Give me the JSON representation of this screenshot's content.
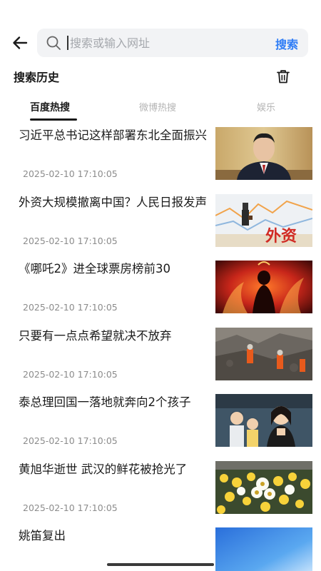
{
  "search": {
    "placeholder": "搜索或输入网址",
    "button_label": "搜索"
  },
  "history": {
    "title": "搜索历史"
  },
  "tabs": [
    {
      "label": "百度热搜",
      "active": true
    },
    {
      "label": "微博热搜",
      "active": false
    },
    {
      "label": "娱乐",
      "active": false
    }
  ],
  "news": [
    {
      "title": "习近平总书记这样部署东北全面振兴",
      "time": "2025-02-10 17:10:05"
    },
    {
      "title": "外资大规模撤离中国？人民日报发声",
      "time": "2025-02-10 17:10:05",
      "thumb_text": "外资"
    },
    {
      "title": "《哪吒2》进全球票房榜前30",
      "time": "2025-02-10 17:10:05"
    },
    {
      "title": "只要有一点点希望就决不放弃",
      "time": "2025-02-10 17:10:05"
    },
    {
      "title": "泰总理回国一落地就奔向2个孩子",
      "time": "2025-02-10 17:10:05"
    },
    {
      "title": "黄旭华逝世 武汉的鲜花被抢光了",
      "time": "2025-02-10 17:10:05"
    },
    {
      "title": "姚笛复出",
      "time": ""
    }
  ],
  "colors": {
    "accent": "#2f7df6",
    "search_bg": "#f2f3f5",
    "muted": "#8c8c8c",
    "tab_inactive": "#b4b4b4"
  }
}
